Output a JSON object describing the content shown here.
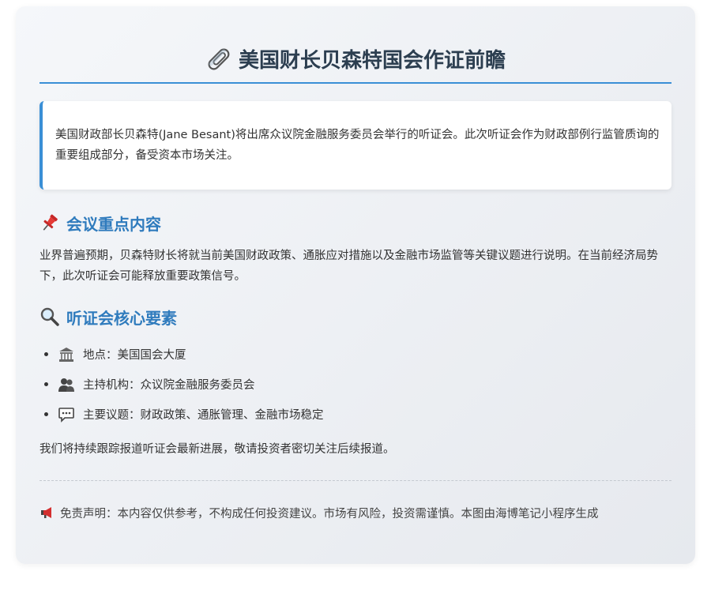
{
  "title": "美国财长贝森特国会作证前瞻",
  "intro": "美国财政部长贝森特(Jane Besant)将出席众议院金融服务委员会举行的听证会。此次听证会作为财政部例行监管质询的重要组成部分，备受资本市场关注。",
  "section1": {
    "icon": "pushpin-icon",
    "title": "会议重点内容",
    "text": "业界普遍预期，贝森特财长将就当前美国财政政策、通胀应对措施以及金融市场监管等关键议题进行说明。在当前经济局势下，此次听证会可能释放重要政策信号。"
  },
  "section2": {
    "icon": "magnifier-icon",
    "title": "听证会核心要素",
    "items": [
      {
        "icon": "capitol-icon",
        "text": "地点：美国国会大厦"
      },
      {
        "icon": "people-icon",
        "text": "主持机构：众议院金融服务委员会"
      },
      {
        "icon": "speech-bubble-icon",
        "text": "主要议题：财政政策、通胀管理、金融市场稳定"
      }
    ]
  },
  "closing": "我们将持续跟踪报道听证会最新进展，敬请投资者密切关注后续报道。",
  "disclaimer": {
    "icon": "megaphone-icon",
    "text": "免责声明：本内容仅供参考，不构成任何投资建议。市场有风险，投资需谨慎。本图由海博笔记小程序生成"
  },
  "colors": {
    "accent": "#3a8fd6",
    "section_title": "#2f7bbd",
    "heading": "#2c3e50"
  }
}
